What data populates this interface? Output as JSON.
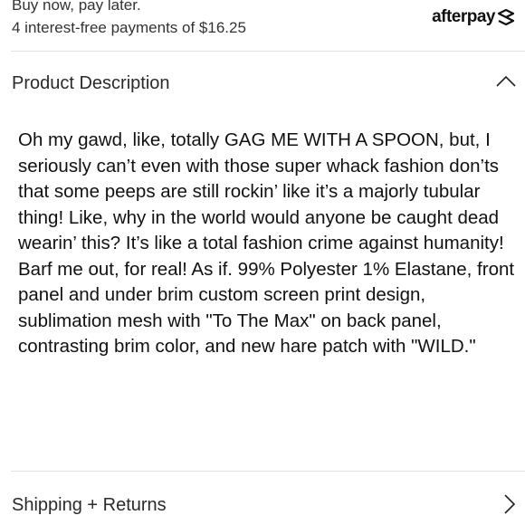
{
  "afterpay": {
    "line1": "Buy now, pay later.",
    "line2": "4 interest-free payments of $16.25",
    "logo_text": "afterpay"
  },
  "product_description": {
    "title": "Product Description",
    "expanded": true,
    "text": "Oh my gawd, like, totally GAG ME WITH A SPOON, but, I seriously can’t even with those super whack fashion don’ts that some peeps are still rockin’ like it’s a majorly tubular thing! Like, why in the world would anyone be caught dead wearin’ this? It’s like a total fashion crime against humanity! Barf me out, for real! As if. 99% Polyester 1% Elastane, front panel and under brim custom screen print design, sublimation mesh with \"To The Max\" on back panel, contrasting brim color, and new hare patch with \"WILD.\""
  },
  "shipping_returns": {
    "title": "Shipping + Returns",
    "expanded": false
  },
  "icons": {
    "collapse": "chevron-up-icon",
    "expand": "chevron-right-icon",
    "brand": "afterpay-logo-icon"
  },
  "colors": {
    "text": "#111111",
    "divider": "#e2e2e2"
  }
}
